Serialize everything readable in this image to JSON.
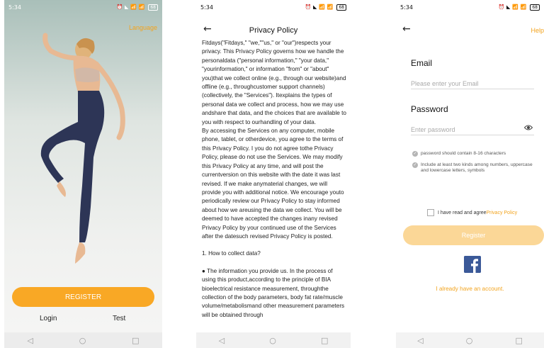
{
  "screen1": {
    "status": {
      "time": "5:34",
      "icons": "⏰ ◣ 📶 📶",
      "battery": "68"
    },
    "language": "Language",
    "register": "REGISTER",
    "login": "Login",
    "test": "Test"
  },
  "screen2": {
    "status": {
      "time": "5:34",
      "icons": "⏰ ◣ 📶 📶",
      "battery": "68"
    },
    "back": "←",
    "title": "Privacy Policy",
    "paragraphs": [
      "Fitdays(\"Fitdays,\" \"we,\"\"us,\" or \"our\")respects your privacy. This Privacy Policy governs how we handle the personaldata (\"personal information,\" \"your data,\" \"yourinformation,\" or information \"from\" or \"about\" you)that we collect online (e.g., through our website)and offline (e.g., throughcustomer support channels) (collectively, the \"Services\"). Itexplains the types of personal data we collect and process, how we may use andshare that data, and the choices that are available to you with respect to ourhandling of your data.",
      "By accessing the Services on any computer, mobile phone, tablet, or otherdevice, you agree to the terms of this Privacy Policy. I you do not agree tothe Privacy Policy, please do not use the Services. We may modify this Privacy Policy at any time, and will post the currentversion on this website with the date it was last revised. If we make anymaterial changes, we will provide you with additional notice. We encourage youto periodically review our Privacy Policy to stay informed about how we areusing the data we collect. You will be deemed to have accepted the changes inany revised Privacy Policy by your continued use of the Services after the datesuch revised Privacy Policy is posted.",
      "1. How to collect data?",
      "● The information you provide us. In the process of using this product,according to the principle of BIA bioelectrical resistance measurement, throughthe collection of the body parameters, body fat rate/muscle volume/metabolismand other measurement parameters will be obtained through"
    ]
  },
  "screen3": {
    "status": {
      "time": "5:34",
      "icons": "⏰ ◣ 📶 📶",
      "battery": "68"
    },
    "back": "←",
    "help": "Help",
    "email_label": "Email",
    "email_placeholder": "Please enter your Email",
    "password_label": "Password",
    "password_placeholder": "Enter password",
    "rule1": "password should contain 8-16 characters",
    "rule2": "Include at least two kinds among numbers, uppercase and lowercase letters, symbols",
    "agree_text": "I have read and agree",
    "privacy_link": "Privacy Policy",
    "register": "Register",
    "facebook": "f",
    "already": "I already have an account."
  },
  "nav": {
    "back": "◁",
    "home": "○",
    "recent": "□"
  },
  "colors": {
    "accent": "#f9a825",
    "accent_light": "#fbd797",
    "link": "#f2a31d",
    "facebook": "#3b5998"
  },
  "icons": [
    "alarm-icon",
    "mute-icon",
    "signal-icon",
    "battery-icon",
    "back-arrow-icon",
    "eye-icon",
    "check-circle-icon",
    "facebook-icon"
  ]
}
